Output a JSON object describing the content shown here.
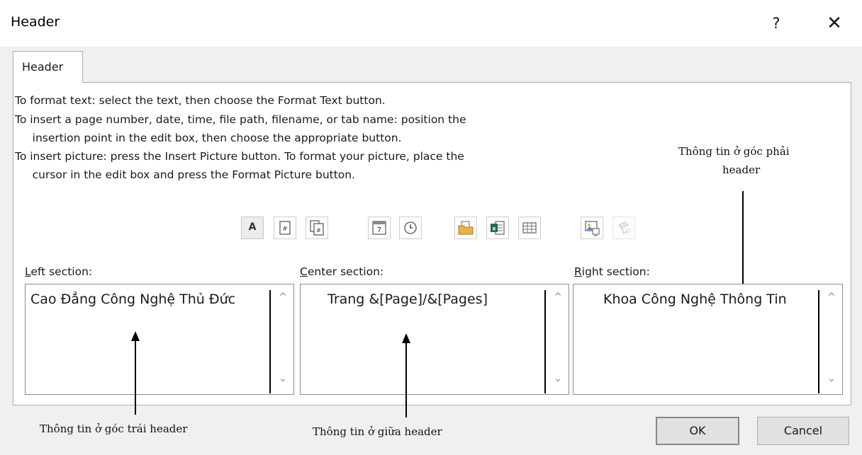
{
  "window": {
    "title": "Header",
    "help_label": "?",
    "close_label": "✕"
  },
  "tab": {
    "label": "Header"
  },
  "instructions": [
    "To format text:  select the text, then choose the Format Text button.",
    "To insert a page number, date, time, file path, filename, or tab name:  position the",
    "     insertion point in the edit box, then choose the appropriate button.",
    "To insert picture: press the Insert Picture button.  To format your picture, place the",
    "     cursor in the edit box and press the Format Picture button."
  ],
  "toolbar": {
    "buttons": [
      {
        "name": "format-text",
        "label": "A",
        "icon": "format-text-icon"
      },
      {
        "name": "insert-page-number",
        "icon": "page-number-icon"
      },
      {
        "name": "insert-number-of-pages",
        "icon": "number-of-pages-icon"
      },
      {
        "name": "insert-date",
        "icon": "calendar-icon"
      },
      {
        "name": "insert-time",
        "icon": "clock-icon"
      },
      {
        "name": "insert-file-path",
        "icon": "folder-icon"
      },
      {
        "name": "insert-file-name",
        "icon": "excel-file-icon"
      },
      {
        "name": "insert-sheet-name",
        "icon": "sheet-tab-icon"
      },
      {
        "name": "insert-picture",
        "icon": "picture-icon"
      },
      {
        "name": "format-picture",
        "icon": "format-picture-icon",
        "disabled": true
      }
    ]
  },
  "sections": {
    "left": {
      "label_key": "L",
      "label_rest": "eft section:",
      "content": "Cao Đẳng Công Nghệ Thủ Đức"
    },
    "center": {
      "label_key": "C",
      "label_rest": "enter section:",
      "content": "Trang &[Page]/&[Pages]"
    },
    "right": {
      "label_key": "R",
      "label_rest": "ight section:",
      "content": "Khoa Công Nghệ Thông Tin"
    }
  },
  "annotations": {
    "right_line1": "Thông tin ở góc phải",
    "right_line2": "header",
    "left": "Thông tin ở góc trái header",
    "center": "Thông tin ở giữa header"
  },
  "buttons": {
    "ok": "OK",
    "cancel": "Cancel"
  }
}
